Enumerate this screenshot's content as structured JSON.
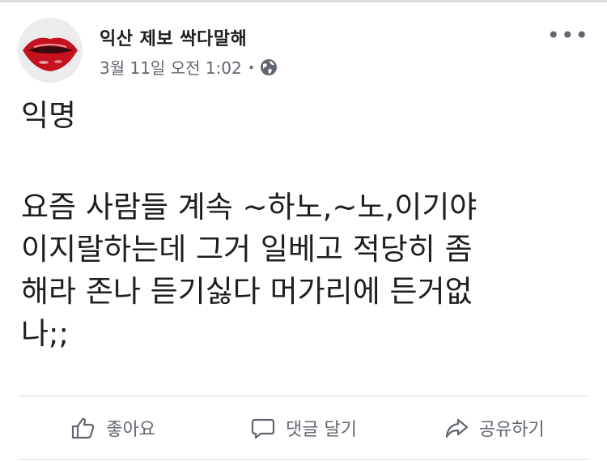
{
  "post": {
    "author": "익산 제보 싹다말해",
    "timestamp": "3월 11일 오전 1:02",
    "separator": "·",
    "privacy_icon": "globe-icon",
    "more_label": "•••",
    "title": "익명",
    "text": "요즘 사람들 계속 ~하노,~노,이기야\n이지랄하는데 그거 일베고 적당히 좀\n해라 존나 듣기싫다 머가리에 든거없\n나;;"
  },
  "actions": {
    "like": {
      "label": "좋아요",
      "icon": "thumbs-up-icon"
    },
    "comment": {
      "label": "댓글 달기",
      "icon": "comment-bubble-icon"
    },
    "share": {
      "label": "공유하기",
      "icon": "share-arrow-icon"
    }
  },
  "colors": {
    "text": "#1c1e21",
    "secondary": "#606770",
    "divider": "#dadde1"
  }
}
